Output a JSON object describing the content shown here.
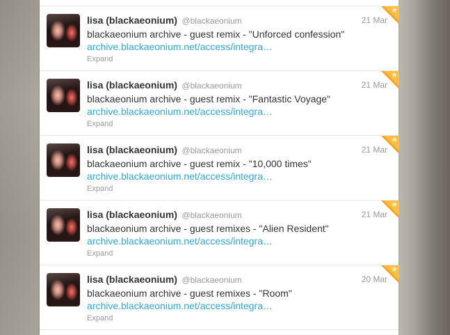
{
  "tweets": [
    {
      "fullname": "lisa (blackaeonium)",
      "handle": "@blackaeonium",
      "date": "21 Mar",
      "text": "blackaeonium archive - guest remix - \"Unforced confession\"",
      "link": "archive.blackaeonium.net/access/integra…",
      "expand": "Expand",
      "favorited": true
    },
    {
      "fullname": "lisa (blackaeonium)",
      "handle": "@blackaeonium",
      "date": "21 Mar",
      "text": "blackaeonium archive - guest remix - \"Fantastic Voyage\"",
      "link": "archive.blackaeonium.net/access/integra…",
      "expand": "Expand",
      "favorited": true
    },
    {
      "fullname": "lisa (blackaeonium)",
      "handle": "@blackaeonium",
      "date": "21 Mar",
      "text": "blackaeonium archive - guest remix - \"10,000 times\"",
      "link": "archive.blackaeonium.net/access/integra…",
      "expand": "Expand",
      "favorited": true
    },
    {
      "fullname": "lisa (blackaeonium)",
      "handle": "@blackaeonium",
      "date": "21 Mar",
      "text": "blackaeonium archive - guest remixes - \"Alien Resident\"",
      "link": "archive.blackaeonium.net/access/integra…",
      "expand": "Expand",
      "favorited": true
    },
    {
      "fullname": "lisa (blackaeonium)",
      "handle": "@blackaeonium",
      "date": "20 Mar",
      "text": "blackaeonium archive - guest remixes - \"Room\"",
      "link": "archive.blackaeonium.net/access/integra…",
      "expand": "Expand",
      "favorited": true
    }
  ],
  "colors": {
    "link": "#2fa8e0",
    "fullname": "#333333",
    "meta": "#999999",
    "favorite_corner": "#f0a32b"
  },
  "icons": {
    "favorite": "star-icon"
  }
}
